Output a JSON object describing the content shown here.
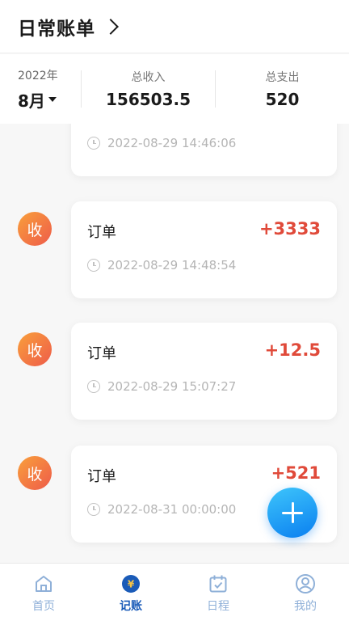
{
  "header": {
    "title": "日常账单"
  },
  "summary": {
    "year": "2022年",
    "month": "8月",
    "income_label": "总收入",
    "income_value": "156503.5",
    "expense_label": "总支出",
    "expense_value": "520"
  },
  "records": [
    {
      "badge": "",
      "name": "",
      "amount": "",
      "time": "2022-08-29 14:46:06"
    },
    {
      "badge": "收",
      "name": "订单",
      "amount": "+3333",
      "time": "2022-08-29 14:48:54"
    },
    {
      "badge": "收",
      "name": "订单",
      "amount": "+12.5",
      "time": "2022-08-29 15:07:27"
    },
    {
      "badge": "收",
      "name": "订单",
      "amount": "+521",
      "time": "2022-08-31 00:00:00"
    }
  ],
  "tabs": [
    {
      "label": "首页",
      "icon": "home-icon",
      "active": false
    },
    {
      "label": "记账",
      "icon": "yuan-icon",
      "active": true
    },
    {
      "label": "日程",
      "icon": "calendar-check-icon",
      "active": false
    },
    {
      "label": "我的",
      "icon": "user-icon",
      "active": false
    }
  ],
  "colors": {
    "income": "#e04a3a",
    "accent": "#1a5bb8",
    "fab": "#0a7ff0",
    "badge": "#ee5b4a"
  }
}
